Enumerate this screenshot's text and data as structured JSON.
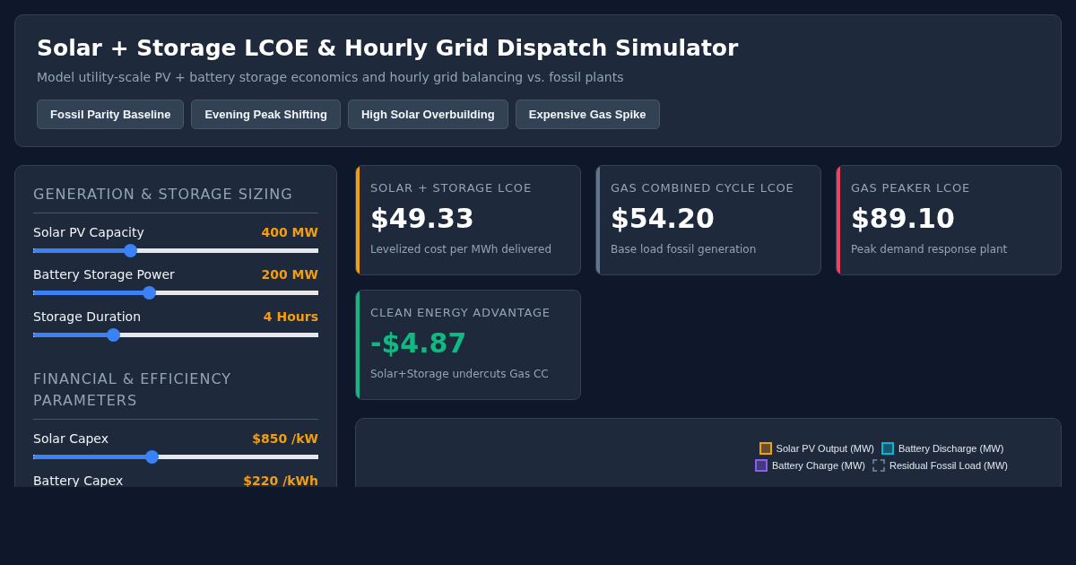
{
  "header": {
    "title": "Solar + Storage LCOE & Hourly Grid Dispatch Simulator",
    "subtitle": "Model utility-scale PV + battery storage economics and hourly grid balancing vs. fossil plants",
    "presets": [
      "Fossil Parity Baseline",
      "Evening Peak Shifting",
      "High Solar Overbuilding",
      "Expensive Gas Spike"
    ]
  },
  "controls": {
    "sections": [
      {
        "title": "GENERATION & STORAGE SIZING",
        "sliders": [
          {
            "label": "Solar PV Capacity",
            "reading": "400 MW",
            "level": 0.34
          },
          {
            "label": "Battery Storage Power",
            "reading": "200 MW",
            "level": 0.405
          },
          {
            "label": "Storage Duration",
            "reading": "4 Hours",
            "level": 0.28
          }
        ]
      },
      {
        "title": "FINANCIAL & EFFICIENCY PARAMETERS",
        "sliders": [
          {
            "label": "Solar Capex",
            "reading": "$850 /kW",
            "level": 0.415
          },
          {
            "label": "Battery Capex",
            "reading": "$220 /kWh"
          }
        ]
      }
    ]
  },
  "metrics": [
    {
      "label": "SOLAR + STORAGE LCOE",
      "value": "$49.33",
      "note": "Levelized cost per MWh delivered",
      "color": "#f59e0b",
      "kind": "cost"
    },
    {
      "label": "GAS COMBINED CYCLE LCOE",
      "value": "$54.20",
      "note": "Base load fossil generation",
      "color": "#64748b",
      "kind": "cost"
    },
    {
      "label": "GAS PEAKER LCOE",
      "value": "$89.10",
      "note": "Peak demand response plant",
      "color": "#f43f5e",
      "kind": "cost"
    },
    {
      "label": "CLEAN ENERGY ADVANTAGE",
      "value": "-$4.87",
      "note": "Solar+Storage undercuts Gas CC",
      "color": "#10b981",
      "kind": "advantage"
    }
  ],
  "chart": {
    "legend": [
      {
        "label": "Solar PV Output (MW)",
        "color": "#f59e0b",
        "kind": "solid"
      },
      {
        "label": "Battery Discharge (MW)",
        "color": "#06b6d4",
        "kind": "solid"
      },
      {
        "label": "Battery Charge (MW)",
        "color": "#8b5cf6",
        "kind": "solid"
      },
      {
        "label": "Residual Fossil Load (MW)",
        "color": "#64748b",
        "kind": "dashed"
      }
    ]
  }
}
